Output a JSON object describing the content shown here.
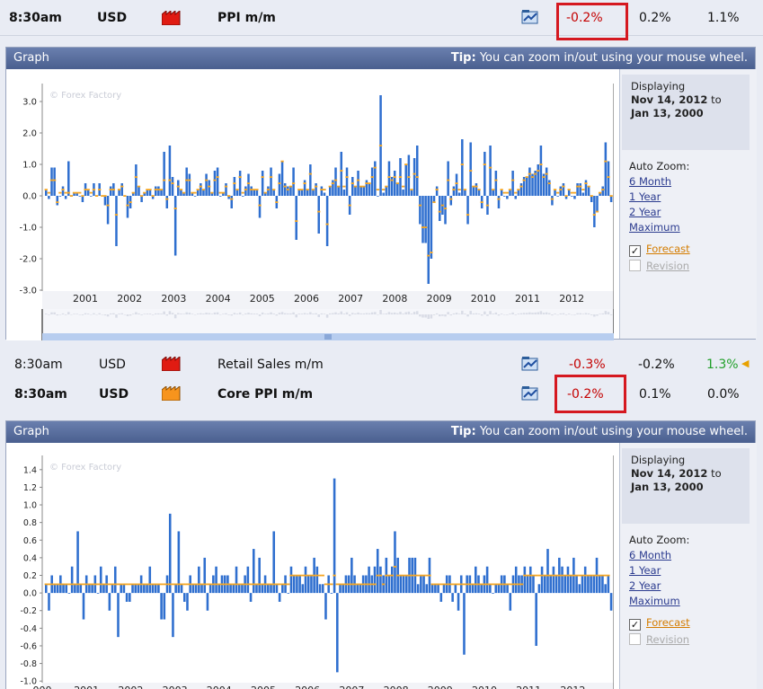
{
  "rows": [
    {
      "time": "8:30am",
      "currency": "USD",
      "impact": "high-impact-icon",
      "impact_color": "#e01b12",
      "event": "PPI m/m",
      "bold": true,
      "actual": "-0.2%",
      "forecast": "0.2%",
      "previous": "1.1%",
      "previous_color": "#111111",
      "highlight": true
    },
    {
      "time": "8:30am",
      "currency": "USD",
      "impact": "high-impact-icon",
      "impact_color": "#e01b12",
      "event": "Retail Sales m/m",
      "bold": false,
      "actual": "-0.3%",
      "forecast": "-0.2%",
      "previous": "1.3%",
      "previous_color": "#22a02a",
      "highlight": false
    },
    {
      "time": "8:30am",
      "currency": "USD",
      "impact": "medium-impact-icon",
      "impact_color": "#f7941d",
      "event": "Core PPI m/m",
      "bold": true,
      "actual": "-0.2%",
      "forecast": "0.1%",
      "previous": "0.0%",
      "previous_color": "#111111",
      "highlight": true
    }
  ],
  "panels": [
    {
      "title": "Graph",
      "tip_label": "Tip:",
      "tip_text": "You can zoom in/out using your mouse wheel.",
      "watermark": "© Forex Factory",
      "displaying_label": "Displaying",
      "date_from": "Nov 14, 2012",
      "to_label": "to",
      "date_to": "Jan 13, 2000",
      "auto_zoom_label": "Auto Zoom:",
      "zoom_options": [
        "6 Month",
        "1 Year",
        "2 Year",
        "Maximum"
      ],
      "forecast_label": "Forecast",
      "revision_label": "Revision"
    },
    {
      "title": "Graph",
      "tip_label": "Tip:",
      "tip_text": "You can zoom in/out using your mouse wheel.",
      "watermark": "© Forex Factory",
      "displaying_label": "Displaying",
      "date_from": "Nov 14, 2012",
      "to_label": "to",
      "date_to": "Jan 13, 2000",
      "auto_zoom_label": "Auto Zoom:",
      "zoom_options": [
        "6 Month",
        "1 Year",
        "2 Year",
        "Maximum"
      ],
      "forecast_label": "Forecast",
      "revision_label": "Revision"
    }
  ],
  "chart_data": [
    {
      "type": "bar",
      "title": "PPI m/m",
      "x_tick_labels": [
        "2001",
        "2002",
        "2003",
        "2004",
        "2005",
        "2006",
        "2007",
        "2008",
        "2009",
        "2010",
        "2011",
        "2012"
      ],
      "y_tick_labels": [
        "3.0",
        "2.0",
        "1.0",
        "0.0",
        "-1.0",
        "-2.0",
        "-3.0"
      ],
      "ylim": [
        -3.4,
        3.4
      ],
      "bar_color": "#2f6fcf",
      "forecast_color": "#f5a623",
      "series": [
        {
          "name": "Actual",
          "values": [
            0.2,
            -0.1,
            0.9,
            0.9,
            -0.3,
            0.0,
            0.3,
            -0.1,
            1.1,
            0.0,
            0.1,
            0.1,
            0.0,
            -0.2,
            0.4,
            0.2,
            0.0,
            0.4,
            0.0,
            0.4,
            0.0,
            -0.3,
            -0.9,
            0.3,
            0.4,
            -1.6,
            0.2,
            0.4,
            0.0,
            -0.7,
            -0.4,
            0.1,
            1.0,
            0.3,
            -0.2,
            0.1,
            0.2,
            0.2,
            -0.1,
            0.3,
            0.3,
            0.2,
            1.4,
            -0.4,
            1.6,
            0.6,
            -1.9,
            0.5,
            0.2,
            0.1,
            0.9,
            0.7,
            0.1,
            0.0,
            0.2,
            0.4,
            0.2,
            0.7,
            0.5,
            0.1,
            0.8,
            0.9,
            0.0,
            0.1,
            0.4,
            -0.1,
            -0.4,
            0.6,
            0.2,
            0.8,
            0.0,
            0.3,
            0.7,
            0.3,
            0.2,
            0.2,
            -0.7,
            0.8,
            0.1,
            0.3,
            0.9,
            0.2,
            -0.4,
            0.7,
            1.1,
            0.4,
            0.3,
            0.3,
            0.9,
            -1.4,
            0.2,
            0.2,
            0.5,
            0.2,
            1.0,
            0.2,
            0.4,
            -1.2,
            0.3,
            0.1,
            -1.6,
            0.3,
            0.5,
            0.9,
            0.3,
            1.4,
            0.2,
            0.9,
            -0.6,
            0.6,
            0.3,
            0.8,
            0.3,
            0.3,
            0.5,
            0.4,
            0.9,
            1.1,
            0.0,
            3.2,
            0.1,
            0.3,
            1.1,
            0.6,
            0.8,
            0.4,
            1.2,
            0.2,
            1.0,
            1.3,
            0.2,
            1.2,
            1.6,
            -0.9,
            -1.5,
            -1.5,
            -2.8,
            -2.0,
            -0.2,
            0.3,
            -0.8,
            -0.6,
            -0.9,
            1.1,
            -0.3,
            0.3,
            0.7,
            0.1,
            1.8,
            0.2,
            -0.9,
            1.7,
            0.3,
            0.4,
            0.2,
            -0.4,
            1.4,
            -0.6,
            1.6,
            0.2,
            0.8,
            -0.4,
            0.2,
            0.0,
            -0.1,
            0.2,
            0.8,
            -0.1,
            0.2,
            0.4,
            0.6,
            0.6,
            0.9,
            0.7,
            0.8,
            1.0,
            1.6,
            0.7,
            0.9,
            0.5,
            -0.3,
            0.2,
            0.0,
            0.3,
            0.4,
            -0.1,
            0.2,
            0.0,
            -0.1,
            0.4,
            0.4,
            0.1,
            0.5,
            0.3,
            -0.2,
            -1.0,
            -0.5,
            0.1,
            0.3,
            1.7,
            1.1,
            -0.2
          ]
        },
        {
          "name": "Forecast",
          "values": [
            0.2,
            0.1,
            0.5,
            0.5,
            -0.2,
            0.1,
            0.2,
            0.1,
            0.1,
            0.0,
            0.1,
            0.1,
            0.1,
            0.0,
            0.2,
            0.2,
            0.1,
            0.2,
            0.0,
            0.2,
            0.0,
            0.0,
            -0.3,
            0.2,
            0.2,
            -0.6,
            0.2,
            0.3,
            0.0,
            -0.3,
            -0.2,
            0.1,
            0.6,
            0.3,
            0.0,
            0.1,
            0.2,
            0.2,
            0.0,
            0.2,
            0.2,
            0.2,
            0.5,
            -0.1,
            0.5,
            0.4,
            -0.4,
            0.3,
            0.2,
            0.1,
            0.5,
            0.5,
            0.1,
            0.1,
            0.2,
            0.3,
            0.2,
            0.5,
            0.3,
            0.1,
            0.5,
            0.6,
            0.1,
            0.1,
            0.3,
            0.0,
            -0.1,
            0.4,
            0.2,
            0.6,
            0.1,
            0.2,
            0.4,
            0.2,
            0.2,
            0.2,
            -0.3,
            0.6,
            0.1,
            0.2,
            0.6,
            0.2,
            -0.2,
            0.4,
            1.1,
            0.3,
            0.2,
            0.3,
            0.4,
            -0.8,
            0.2,
            0.2,
            0.4,
            0.2,
            0.7,
            0.2,
            0.3,
            -0.5,
            0.2,
            0.2,
            -0.9,
            0.3,
            0.4,
            0.5,
            0.3,
            0.8,
            0.3,
            0.6,
            -0.3,
            0.4,
            0.3,
            0.5,
            0.3,
            0.3,
            0.4,
            0.4,
            0.6,
            0.9,
            0.2,
            1.6,
            0.2,
            0.3,
            0.6,
            0.5,
            0.6,
            0.4,
            0.6,
            0.3,
            1.0,
            0.6,
            0.2,
            0.7,
            0.6,
            -0.3,
            -1.0,
            -1.0,
            -1.9,
            -1.8,
            -0.2,
            0.2,
            -0.5,
            -0.3,
            -0.4,
            0.5,
            -0.1,
            0.2,
            0.4,
            0.2,
            1.0,
            0.2,
            -0.6,
            0.8,
            0.3,
            0.3,
            0.2,
            -0.2,
            1.0,
            -0.3,
            0.9,
            0.2,
            0.5,
            -0.1,
            0.2,
            0.1,
            0.1,
            0.2,
            0.5,
            0.1,
            0.2,
            0.3,
            0.5,
            0.6,
            0.7,
            0.6,
            0.7,
            0.8,
            1.0,
            0.6,
            0.7,
            0.4,
            -0.1,
            0.2,
            0.1,
            0.2,
            0.3,
            0.0,
            0.2,
            0.1,
            0.1,
            0.3,
            0.3,
            0.2,
            0.4,
            0.3,
            0.0,
            -0.6,
            -0.5,
            0.1,
            0.2,
            1.1,
            0.6,
            0.0
          ]
        }
      ]
    },
    {
      "type": "bar",
      "title": "Core PPI m/m",
      "x_tick_labels": [
        "000",
        "2001",
        "2002",
        "2003",
        "2004",
        "2005",
        "2006",
        "2007",
        "2008",
        "2009",
        "2010",
        "2011",
        "2012"
      ],
      "y_tick_labels": [
        "1.4",
        "1.2",
        "1.0",
        "0.8",
        "0.6",
        "0.4",
        "0.2",
        "0.0",
        "-0.2",
        "-0.4",
        "-0.6",
        "-0.8",
        "-1.0"
      ],
      "ylim": [
        -1.1,
        1.5
      ],
      "bar_color": "#2f6fcf",
      "forecast_color": "#f5a623",
      "series": [
        {
          "name": "Actual",
          "values": [
            0.1,
            -0.2,
            0.2,
            0.1,
            0.1,
            0.2,
            0.1,
            0.1,
            0.0,
            0.3,
            0.1,
            0.7,
            0.1,
            -0.3,
            0.2,
            0.1,
            0.1,
            0.2,
            0.0,
            0.3,
            0.1,
            0.2,
            -0.2,
            0.1,
            0.3,
            -0.5,
            0.1,
            0.1,
            -0.1,
            -0.1,
            0.1,
            0.1,
            0.1,
            0.2,
            0.1,
            0.1,
            0.3,
            0.1,
            0.1,
            0.1,
            -0.3,
            -0.3,
            0.2,
            0.9,
            -0.5,
            0.1,
            0.7,
            0.1,
            -0.1,
            -0.2,
            0.2,
            0.1,
            0.1,
            0.3,
            0.1,
            0.4,
            -0.2,
            0.1,
            0.2,
            0.3,
            0.1,
            0.2,
            0.2,
            0.2,
            0.1,
            0.1,
            0.3,
            0.1,
            0.1,
            0.2,
            0.3,
            -0.1,
            0.5,
            0.1,
            0.4,
            0.1,
            0.2,
            0.1,
            0.1,
            0.7,
            0.1,
            -0.1,
            0.1,
            0.2,
            0.0,
            0.3,
            0.2,
            0.2,
            0.2,
            0.1,
            0.3,
            0.2,
            0.2,
            0.4,
            0.3,
            0.1,
            0.1,
            -0.3,
            0.2,
            0.0,
            1.3,
            -0.9,
            0.1,
            0.1,
            0.2,
            0.2,
            0.4,
            0.2,
            0.1,
            0.1,
            0.2,
            0.2,
            0.3,
            0.2,
            0.3,
            0.5,
            0.3,
            0.2,
            0.4,
            0.2,
            0.3,
            0.7,
            0.4,
            0.2,
            0.2,
            0.2,
            0.4,
            0.4,
            0.4,
            0.1,
            0.2,
            0.2,
            0.1,
            0.4,
            0.1,
            0.1,
            0.1,
            -0.1,
            0.1,
            0.2,
            0.2,
            -0.1,
            0.1,
            -0.2,
            0.2,
            -0.7,
            0.2,
            0.2,
            0.1,
            0.3,
            0.2,
            0.1,
            0.2,
            0.3,
            0.1,
            0.0,
            0.1,
            0.1,
            0.2,
            0.2,
            0.1,
            -0.2,
            0.2,
            0.3,
            0.2,
            0.2,
            0.3,
            0.2,
            0.3,
            0.2,
            -0.6,
            0.1,
            0.3,
            0.2,
            0.5,
            0.2,
            0.3,
            0.2,
            0.4,
            0.3,
            0.2,
            0.3,
            0.2,
            0.4,
            0.2,
            0.1,
            0.2,
            0.3,
            0.2,
            0.2,
            0.2,
            0.4,
            0.2,
            0.2,
            0.1,
            0.2,
            -0.2
          ]
        },
        {
          "name": "Forecast",
          "values": [
            0.1,
            0.1,
            0.1,
            0.1,
            0.1,
            0.1,
            0.1,
            0.1,
            0.1,
            0.1,
            0.1,
            0.1,
            0.1,
            0.1,
            0.1,
            0.1,
            0.1,
            0.1,
            0.1,
            0.1,
            0.1,
            0.1,
            0.1,
            0.1,
            0.1,
            0.1,
            0.1,
            0.1,
            0.1,
            0.1,
            0.1,
            0.1,
            0.1,
            0.1,
            0.1,
            0.1,
            0.1,
            0.1,
            0.1,
            0.1,
            0.1,
            0.1,
            0.1,
            0.1,
            0.1,
            0.1,
            0.1,
            0.1,
            0.1,
            0.1,
            0.1,
            0.1,
            0.1,
            0.1,
            0.1,
            0.1,
            0.1,
            0.1,
            0.1,
            0.1,
            0.1,
            0.1,
            0.1,
            0.1,
            0.1,
            0.1,
            0.1,
            0.1,
            0.1,
            0.1,
            0.1,
            0.1,
            0.1,
            0.1,
            0.1,
            0.1,
            0.1,
            0.1,
            0.1,
            0.1,
            0.1,
            0.1,
            0.1,
            0.1,
            0.1,
            0.2,
            0.2,
            0.2,
            0.2,
            0.2,
            0.2,
            0.2,
            0.2,
            0.2,
            0.2,
            0.2,
            0.2,
            0.1,
            0.1,
            0.1,
            0.2,
            0.1,
            0.1,
            0.1,
            0.1,
            0.1,
            0.1,
            0.1,
            0.1,
            0.1,
            0.1,
            0.1,
            0.1,
            0.1,
            0.1,
            0.2,
            0.2,
            0.1,
            0.2,
            0.2,
            0.2,
            0.3,
            0.2,
            0.2,
            0.2,
            0.2,
            0.2,
            0.2,
            0.2,
            0.2,
            0.2,
            0.2,
            0.2,
            0.2,
            0.1,
            0.1,
            0.1,
            0.1,
            0.1,
            0.1,
            0.1,
            0.1,
            0.1,
            0.1,
            0.1,
            0.1,
            0.1,
            0.1,
            0.1,
            0.1,
            0.1,
            0.1,
            0.1,
            0.1,
            0.1,
            0.1,
            0.1,
            0.1,
            0.1,
            0.1,
            0.1,
            0.1,
            0.1,
            0.1,
            0.1,
            0.1,
            0.2,
            0.2,
            0.2,
            0.2,
            0.2,
            0.2,
            0.2,
            0.2,
            0.2,
            0.2,
            0.2,
            0.2,
            0.2,
            0.2,
            0.2,
            0.2,
            0.2,
            0.2,
            0.2,
            0.2,
            0.2,
            0.2,
            0.2,
            0.2,
            0.2,
            0.2,
            0.2,
            0.2,
            0.2,
            0.2
          ]
        }
      ]
    }
  ]
}
